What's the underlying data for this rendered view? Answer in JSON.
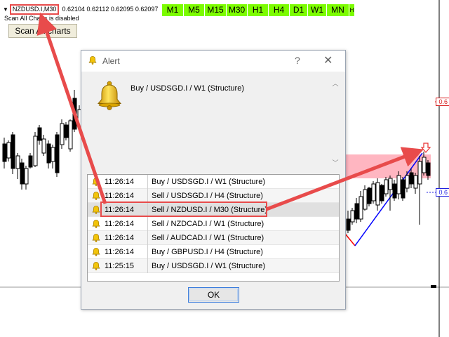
{
  "chart": {
    "symbol": "NZDUSD.I,M30",
    "prices": "0.62104 0.62112 0.62095 0.62097",
    "scan_status": "Scan All Charts is disabled",
    "scan_button": "Scan All charts",
    "timeframes": [
      "M1",
      "M5",
      "M15",
      "M30",
      "H1",
      "H4",
      "D1",
      "W1",
      "MN",
      "H"
    ],
    "price_tag_top": "0.6",
    "price_tag_mid": "0.6",
    "colors": {
      "bull": "#000000",
      "zone": "#ffb6c1",
      "up_line": "#0000ff",
      "down_line": "#ff0000",
      "timeframe_bg": "#7cfc00",
      "annotation": "#e84b4b"
    }
  },
  "dialog": {
    "title": "Alert",
    "help": "?",
    "close": "✕",
    "message": "Buy / USDSGD.I / W1 (Structure)",
    "ok_label": "OK",
    "rows": [
      {
        "time": "11:26:14",
        "text": "Buy / USDSGD.I / W1 (Structure)"
      },
      {
        "time": "11:26:14",
        "text": "Sell / USDSGD.I / H4 (Structure)"
      },
      {
        "time": "11:26:14",
        "text": "Sell / NZDUSD.I / M30 (Structure)"
      },
      {
        "time": "11:26:14",
        "text": "Sell / NZDCAD.I / W1 (Structure)"
      },
      {
        "time": "11:26:14",
        "text": "Sell / AUDCAD.I / W1 (Structure)"
      },
      {
        "time": "11:26:14",
        "text": "Buy / GBPUSD.I / H4 (Structure)"
      },
      {
        "time": "11:25:15",
        "text": "Buy / USDSGD.I / W1 (Structure)"
      }
    ]
  }
}
